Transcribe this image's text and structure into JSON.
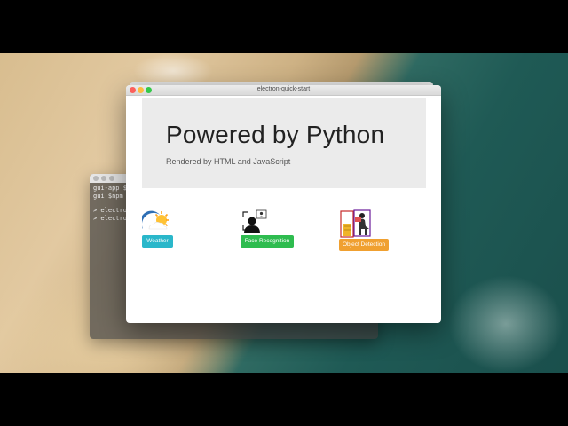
{
  "window": {
    "title": "electron-quick-start"
  },
  "jumbotron": {
    "heading": "Powered by Python",
    "subtitle": "Rendered by HTML and JavaScript"
  },
  "features": {
    "weather": {
      "label": "Weather",
      "color": "#2ab7ca",
      "icon": "weather-icon"
    },
    "face": {
      "label": "Face Recognition",
      "color": "#2ebc4f",
      "icon": "face-recognition-icon"
    },
    "object": {
      "label": "Object Detection",
      "color": "#f0a030",
      "icon": "object-detection-icon"
    }
  },
  "terminal": {
    "lines": [
      "gui-app $c",
      "gui $npm s",
      "> electron",
      "> electron"
    ]
  }
}
